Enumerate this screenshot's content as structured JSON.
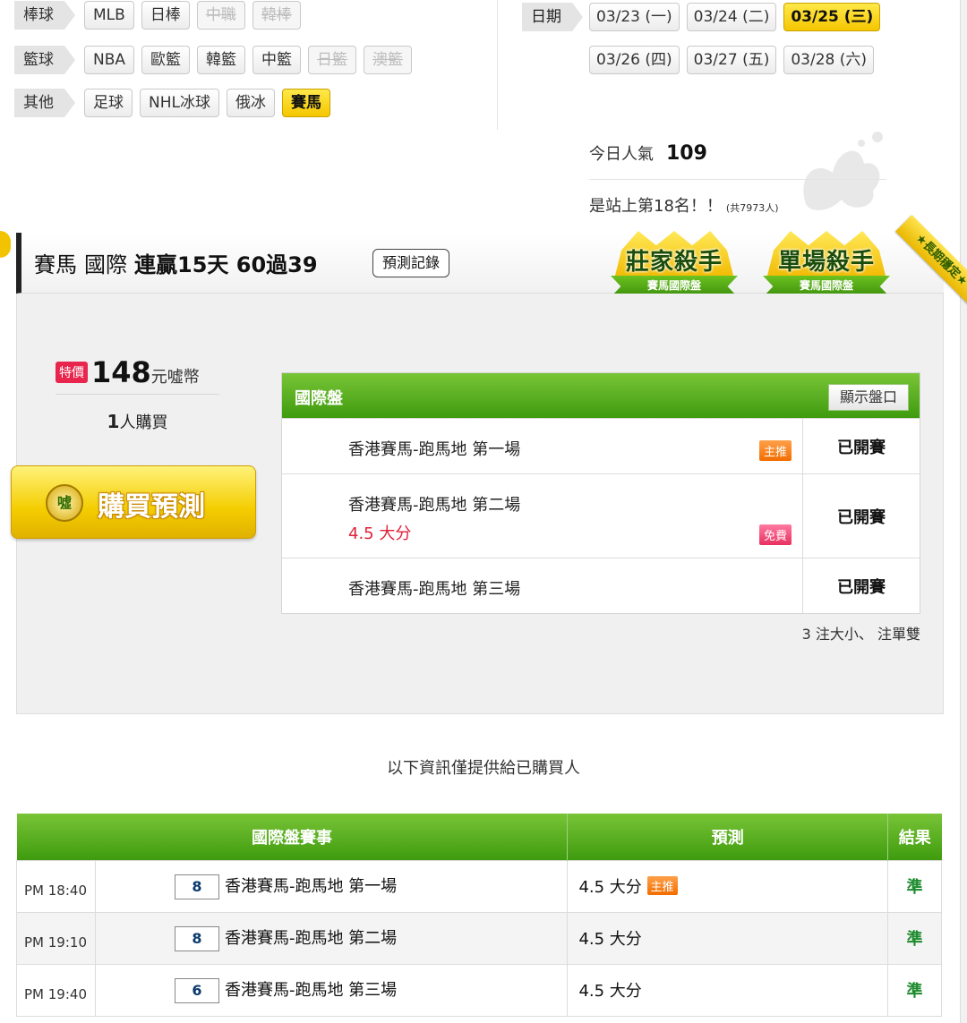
{
  "filters": {
    "rows": [
      {
        "category": "棒球",
        "chips": [
          {
            "label": "MLB",
            "state": "normal"
          },
          {
            "label": "日棒",
            "state": "normal"
          },
          {
            "label": "中職",
            "state": "disabled"
          },
          {
            "label": "韓棒",
            "state": "disabled"
          }
        ]
      },
      {
        "category": "籃球",
        "chips": [
          {
            "label": "NBA",
            "state": "normal"
          },
          {
            "label": "歐籃",
            "state": "normal"
          },
          {
            "label": "韓籃",
            "state": "normal"
          },
          {
            "label": "中籃",
            "state": "normal"
          },
          {
            "label": "日籃",
            "state": "disabled"
          },
          {
            "label": "澳籃",
            "state": "disabled"
          }
        ]
      },
      {
        "category": "其他",
        "chips": [
          {
            "label": "足球",
            "state": "normal"
          },
          {
            "label": "NHL冰球",
            "state": "normal"
          },
          {
            "label": "俄冰",
            "state": "normal"
          },
          {
            "label": "賽馬",
            "state": "active"
          }
        ]
      }
    ]
  },
  "dates": {
    "label": "日期",
    "items": [
      {
        "label": "03/23 (一)",
        "state": "normal"
      },
      {
        "label": "03/24 (二)",
        "state": "normal"
      },
      {
        "label": "03/25 (三)",
        "state": "active"
      },
      {
        "label": "03/26 (四)",
        "state": "normal"
      },
      {
        "label": "03/27 (五)",
        "state": "normal"
      },
      {
        "label": "03/28 (六)",
        "state": "normal"
      }
    ]
  },
  "popularity": {
    "label": "今日人氣",
    "count": "109",
    "rank_text": "是站上第18名！！",
    "total_text": "(共7973人)"
  },
  "banner": {
    "sport": "賽馬",
    "type": "國際",
    "streak": "連贏15天 60過39",
    "record_button": "預測記錄",
    "badges": [
      {
        "title": "莊家殺手",
        "subtitle": "賽馬國際盤"
      },
      {
        "title": "單場殺手",
        "subtitle": "賽馬國際盤"
      }
    ],
    "corner_ribbon": "★長期穩定★"
  },
  "purchase": {
    "special_tag": "特價",
    "price": "148",
    "unit": "元噓幣",
    "buyer_count": "1",
    "buyer_suffix": "人購買",
    "coin_label": "噓",
    "buy_button": "購買預測"
  },
  "market": {
    "title": "國際盤",
    "show_odds_button": "顯示盤口",
    "rows": [
      {
        "game": "香港賽馬-跑馬地 第一場",
        "pick": "",
        "tag": "主推",
        "status": "已開賽"
      },
      {
        "game": "香港賽馬-跑馬地 第二場",
        "pick": "4.5 大分",
        "tag": "免費",
        "status": "已開賽"
      },
      {
        "game": "香港賽馬-跑馬地 第三場",
        "pick": "",
        "tag": "",
        "status": "已開賽"
      }
    ],
    "bet_note": "3 注大小、 注單雙"
  },
  "info_note": "以下資訊僅提供給已購買人",
  "results": {
    "headers": {
      "game": "國際盤賽事",
      "prediction": "預測",
      "result": "結果"
    },
    "rows": [
      {
        "time": "PM 18:40",
        "number": "8",
        "game": "香港賽馬-跑馬地 第一場",
        "prediction": "4.5 大分",
        "tag": "主推",
        "result": "準"
      },
      {
        "time": "PM 19:10",
        "number": "8",
        "game": "香港賽馬-跑馬地 第二場",
        "prediction": "4.5 大分",
        "tag": "",
        "result": "準"
      },
      {
        "time": "PM 19:40",
        "number": "6",
        "game": "香港賽馬-跑馬地 第三場",
        "prediction": "4.5 大分",
        "tag": "",
        "result": "準"
      }
    ]
  },
  "colors": {
    "accent_green": "#3f9b0e",
    "active_yellow": "#f5c600",
    "pick_red": "#e0213a",
    "result_green": "#1c8a2c"
  }
}
